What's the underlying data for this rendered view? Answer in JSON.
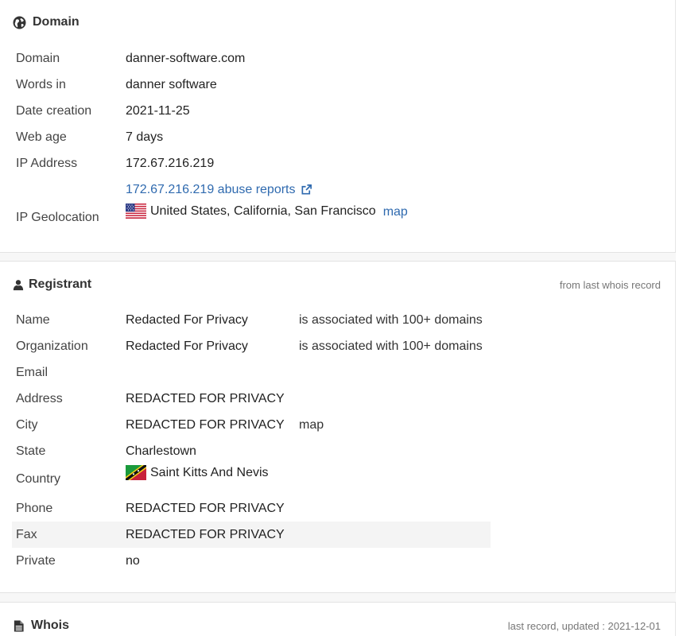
{
  "domain_section": {
    "title": "Domain",
    "rows": {
      "domain": {
        "label": "Domain",
        "value": "danner-software.com"
      },
      "words": {
        "label": "Words in",
        "value": "danner software"
      },
      "date": {
        "label": "Date creation",
        "value": "2021-11-25"
      },
      "age": {
        "label": "Web age",
        "value": "7 days"
      },
      "ip": {
        "label": "IP Address",
        "value": "172.67.216.219"
      },
      "abuse": {
        "label": "",
        "value": "172.67.216.219 abuse reports"
      },
      "geo": {
        "label": "IP Geolocation",
        "value": "United States, California, San Francisco",
        "map": "map"
      }
    }
  },
  "registrant": {
    "title": "Registrant",
    "note": "from last whois record",
    "rows": {
      "name": {
        "label": "Name",
        "value": "Redacted For Privacy",
        "extra": "is associated with 100+ domains"
      },
      "org": {
        "label": "Organization",
        "value": "Redacted For Privacy",
        "extra": "is associated with 100+ domains"
      },
      "email": {
        "label": "Email",
        "value": ""
      },
      "address": {
        "label": "Address",
        "value": "REDACTED FOR PRIVACY"
      },
      "city": {
        "label": "City",
        "value": "REDACTED FOR PRIVACY",
        "map": "map"
      },
      "state": {
        "label": "State",
        "value": "Charlestown"
      },
      "country": {
        "label": "Country",
        "value": "Saint Kitts And Nevis"
      },
      "phone": {
        "label": "Phone",
        "value": "REDACTED FOR PRIVACY"
      },
      "fax": {
        "label": "Fax",
        "value": "REDACTED FOR PRIVACY"
      },
      "private": {
        "label": "Private",
        "value": "no"
      }
    }
  },
  "whois": {
    "title": "Whois",
    "note": "last record, updated : 2021-12-01"
  },
  "colors": {
    "link": "#2f6aaf",
    "text": "#333333",
    "muted": "#777777",
    "shade": "#f4f4f4"
  },
  "icons": {
    "domain": "globe-icon",
    "registrant": "user-icon",
    "whois": "document-icon",
    "external": "external-link-icon"
  }
}
